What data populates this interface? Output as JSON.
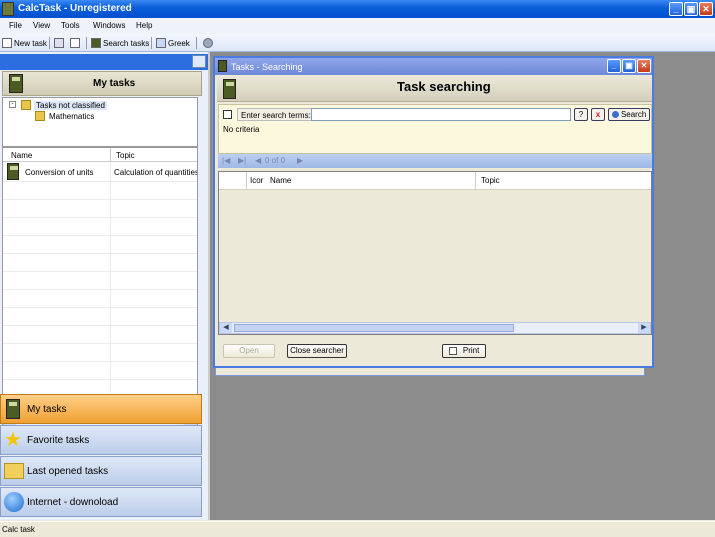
{
  "app": {
    "title": "CalcTask - Unregistered",
    "window_buttons": [
      "_",
      "▣",
      "✕"
    ]
  },
  "menu": [
    "File",
    "View",
    "Tools",
    "Windows",
    "Help"
  ],
  "toolbar": {
    "new_task": "New task",
    "search_tasks": "Search tasks",
    "greek": "Greek"
  },
  "left": {
    "title": "My tasks",
    "tree": {
      "root": "Tasks not classified",
      "child": "Mathematics"
    },
    "grid": {
      "columns": [
        "Name",
        "Topic"
      ],
      "rows": [
        {
          "name": "Conversion of units",
          "topic": "Calculation of quantities t"
        }
      ]
    },
    "nav": {
      "my_tasks": "My tasks",
      "favorite": "Favorite tasks",
      "last_opened": "Last opened tasks",
      "internet": "Internet - downoload"
    }
  },
  "search_window": {
    "title": "Tasks - Searching",
    "heading": "Task searching",
    "label": "Enter search terms:",
    "input_value": "",
    "help_btn": "?",
    "clear_btn": "x",
    "search_btn": "Search",
    "criteria": "No criteria",
    "pager": {
      "position": "0 of 0"
    },
    "columns": [
      "Icor",
      "Name",
      "Topic"
    ],
    "open_btn": "Open",
    "close_btn": "Close searcher",
    "print_btn": "Print"
  },
  "status": "Calc task",
  "colors": {
    "accent": "#0a5fd8",
    "active_nav": "#f0a032",
    "workspace": "#8c8c8c"
  }
}
